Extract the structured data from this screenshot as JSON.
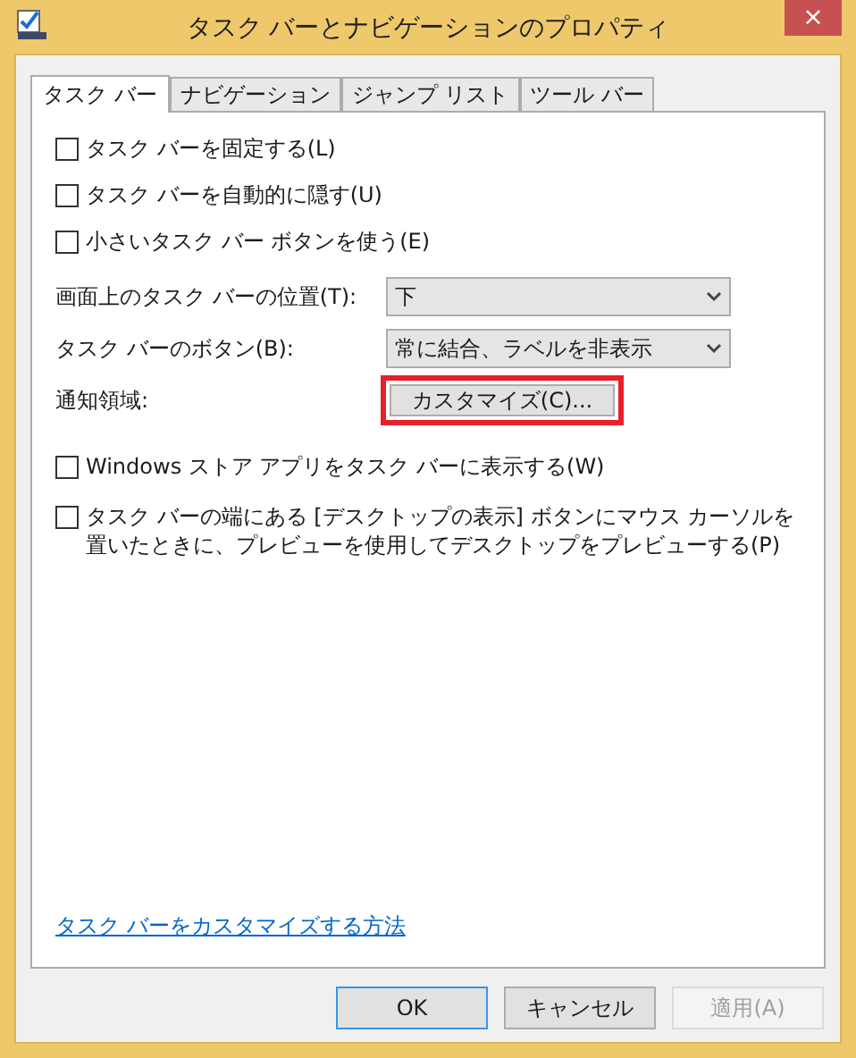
{
  "window": {
    "title": "タスク バーとナビゲーションのプロパティ",
    "close": "×"
  },
  "tabs": [
    {
      "label": "タスク バー",
      "selected": true
    },
    {
      "label": "ナビゲーション",
      "selected": false
    },
    {
      "label": "ジャンプ リスト",
      "selected": false
    },
    {
      "label": "ツール バー",
      "selected": false
    }
  ],
  "options_top": [
    {
      "label": "タスク バーを固定する(L)",
      "checked": false
    },
    {
      "label": "タスク バーを自動的に隠す(U)",
      "checked": false
    },
    {
      "label": "小さいタスク バー ボタンを使う(E)",
      "checked": false
    }
  ],
  "settings": [
    {
      "kind": "dropdown",
      "label": "画面上のタスク バーの位置(T):",
      "value": "下"
    },
    {
      "kind": "dropdown",
      "label": "タスク バーのボタン(B):",
      "value": "常に結合、ラベルを非表示"
    },
    {
      "kind": "button",
      "label": "通知領域:",
      "button": "カスタマイズ(C)...",
      "highlighted": true
    }
  ],
  "options_bottom": [
    {
      "label": "Windows ストア アプリをタスク バーに表示する(W)",
      "checked": false
    },
    {
      "label": "タスク バーの端にある [デスクトップの表示] ボタンにマウス カーソルを置いたときに、プレビューを使用してデスクトップをプレビューする(P)",
      "checked": false
    }
  ],
  "help_link": "タスク バーをカスタマイズする方法",
  "buttons": [
    {
      "label": "OK",
      "default": true,
      "disabled": false
    },
    {
      "label": "キャンセル",
      "default": false,
      "disabled": false
    },
    {
      "label": "適用(A)",
      "default": false,
      "disabled": true
    }
  ]
}
